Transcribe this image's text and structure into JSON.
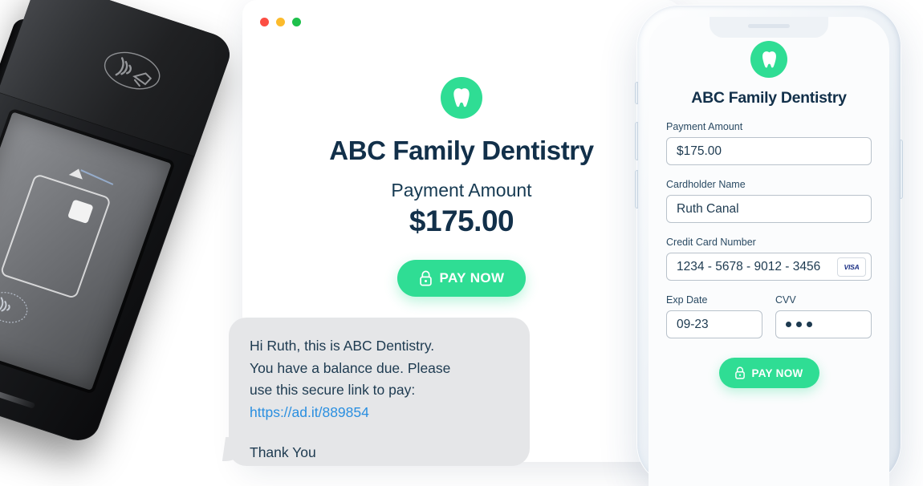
{
  "browser": {
    "window_controls": [
      {
        "name": "close",
        "color": "#fc4e43"
      },
      {
        "name": "minimize",
        "color": "#fcbb2c"
      },
      {
        "name": "maximize",
        "color": "#1ec04b"
      }
    ],
    "logo_icon": "tooth-icon",
    "brand_title": "ABC Family Dentistry",
    "amount_label": "Payment Amount",
    "amount_value": "$175.00",
    "pay_button": {
      "label": "PAY NOW",
      "icon": "lock-icon",
      "color": "#2fdd94"
    }
  },
  "sms": {
    "line1": "Hi Ruth, this is ABC Dentistry.",
    "line2": "You have a balance due. Please",
    "line3": "use this secure link to pay:",
    "link": "https://ad.it/889854",
    "closing": "Thank You",
    "bubble_color": "#e5e6e8",
    "link_color": "#2a8fe0"
  },
  "phone": {
    "logo_icon": "tooth-icon",
    "brand_title": "ABC Family Dentistry",
    "fields": {
      "payment_amount": {
        "label": "Payment Amount",
        "value": "$175.00"
      },
      "cardholder_name": {
        "label": "Cardholder Name",
        "value": "Ruth Canal"
      },
      "credit_card_number": {
        "label": "Credit Card Number",
        "value": "1234 - 5678 - 9012 - 3456",
        "brand_badge": "VISA"
      },
      "exp_date": {
        "label": "Exp Date",
        "value": "09-23"
      },
      "cvv": {
        "label": "CVV",
        "value": "●●●",
        "masked_count": 3
      }
    },
    "pay_button": {
      "label": "PAY NOW",
      "icon": "lock-icon",
      "color": "#2fdd94"
    }
  },
  "terminal": {
    "device": "pos-payment-terminal",
    "contactless_icon": "nfc-contactless-icon",
    "screen_graphic": "insert-card-prompt"
  },
  "theme": {
    "accent_green": "#2fdd94",
    "navy_text": "#12304a",
    "body_text": "#1d3a50",
    "page_background": "#ffffff"
  }
}
